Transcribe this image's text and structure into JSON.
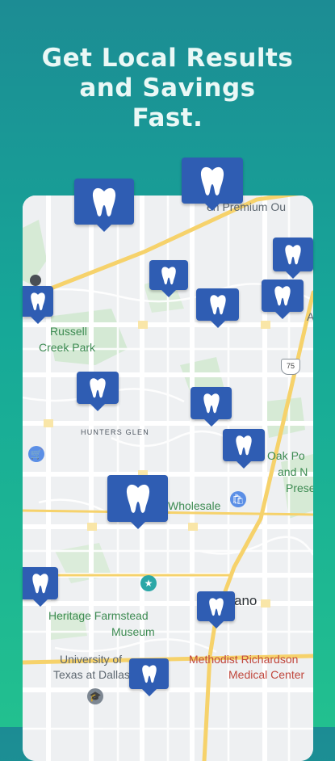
{
  "headline": {
    "line1": "Get Local Results",
    "line2": "and Savings",
    "line3": "Fast."
  },
  "colors": {
    "brand_blue": "#2f5db3",
    "bg_teal": "#1c8c94",
    "bg_green": "#22c08f"
  },
  "map": {
    "labels": {
      "premium_outlets": "en Premium Ou",
      "russell": "Russell",
      "creek_park": "Creek Park",
      "hunters_glen": "HUNTERS GLEN",
      "oak_point_1": "Oak Po",
      "oak_point_2": "and N",
      "oak_point_3": "Prese",
      "wholesale": "Wholesale",
      "plano": "ano",
      "heritage_1": "Heritage Farmstead",
      "heritage_2": "Museum",
      "university_1": "University of",
      "university_2": "Texas at Dallas",
      "methodist_1": "Methodist Richardson",
      "methodist_2": "Medical Center",
      "edge_a": "A",
      "highway_75": "75"
    },
    "marker_icon": "tooth-icon"
  }
}
